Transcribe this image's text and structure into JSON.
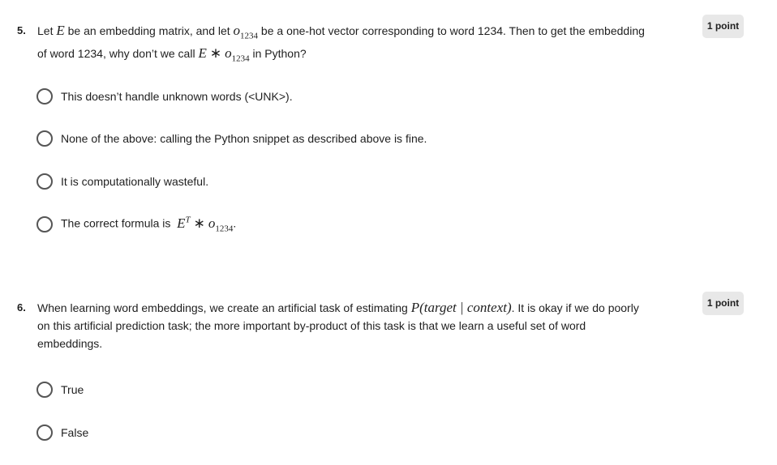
{
  "questions": [
    {
      "number": "5.",
      "points": "1 point",
      "text": {
        "t1": "Let ",
        "m1": "E",
        "t2": " be an embedding matrix, and let ",
        "m2": "o",
        "m2sub": "1234",
        "t3": " be a one-hot vector corresponding to word 1234. Then to get the embedding of word 1234, why don’t we call ",
        "m3a": "E",
        "m3op": "∗",
        "m3b": "o",
        "m3sub": "1234",
        "t4": " in Python?"
      },
      "options": [
        {
          "label": "This doesn’t handle unknown words (<UNK>)."
        },
        {
          "label": "None of the above: calling the Python snippet as described above is fine."
        },
        {
          "label": "It is computationally wasteful."
        },
        {
          "label": "The correct formula is ",
          "m_a": "E",
          "m_sup": "T",
          "m_op": "∗",
          "m_b": "o",
          "m_sub": "1234",
          "tail": "."
        }
      ]
    },
    {
      "number": "6.",
      "points": "1 point",
      "text": {
        "t1": "When learning word embeddings, we create an artificial task of estimating ",
        "math": "P(target | context)",
        "t2": ". It is okay if we do poorly on this artificial prediction task; the more important by-product of this task is that we learn a useful set of word embeddings."
      },
      "options": [
        {
          "label": "True"
        },
        {
          "label": "False"
        }
      ]
    }
  ]
}
